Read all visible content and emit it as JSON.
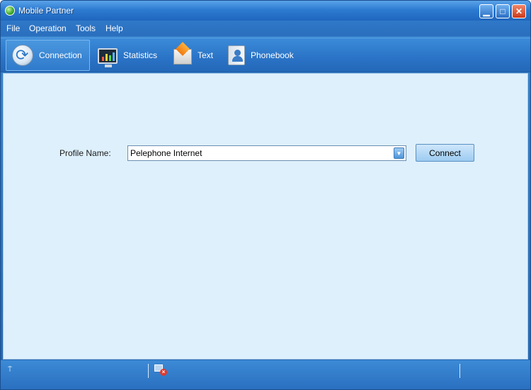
{
  "window": {
    "title": "Mobile Partner",
    "minimize_glyph": "▁",
    "maximize_glyph": "□",
    "close_glyph": "✕"
  },
  "menu": {
    "items": [
      "File",
      "Operation",
      "Tools",
      "Help"
    ]
  },
  "toolbar": {
    "items": [
      {
        "label": "Connection",
        "icon": "connection-icon",
        "active": true
      },
      {
        "label": "Statistics",
        "icon": "monitor-chart-icon",
        "active": false
      },
      {
        "label": "Text",
        "icon": "envelope-icon",
        "active": false
      },
      {
        "label": "Phonebook",
        "icon": "contacts-book-icon",
        "active": false
      }
    ]
  },
  "connection": {
    "profile_label": "Profile Name:",
    "profile_value": "Pelephone Internet",
    "connect_label": "Connect"
  },
  "statusbar": {
    "signal_glyph": "⍑",
    "network_status_icon": "network-disconnected-icon"
  },
  "colors": {
    "accent": "#2a73c6",
    "content_bg": "#def0fc",
    "close": "#cc3a1a"
  }
}
